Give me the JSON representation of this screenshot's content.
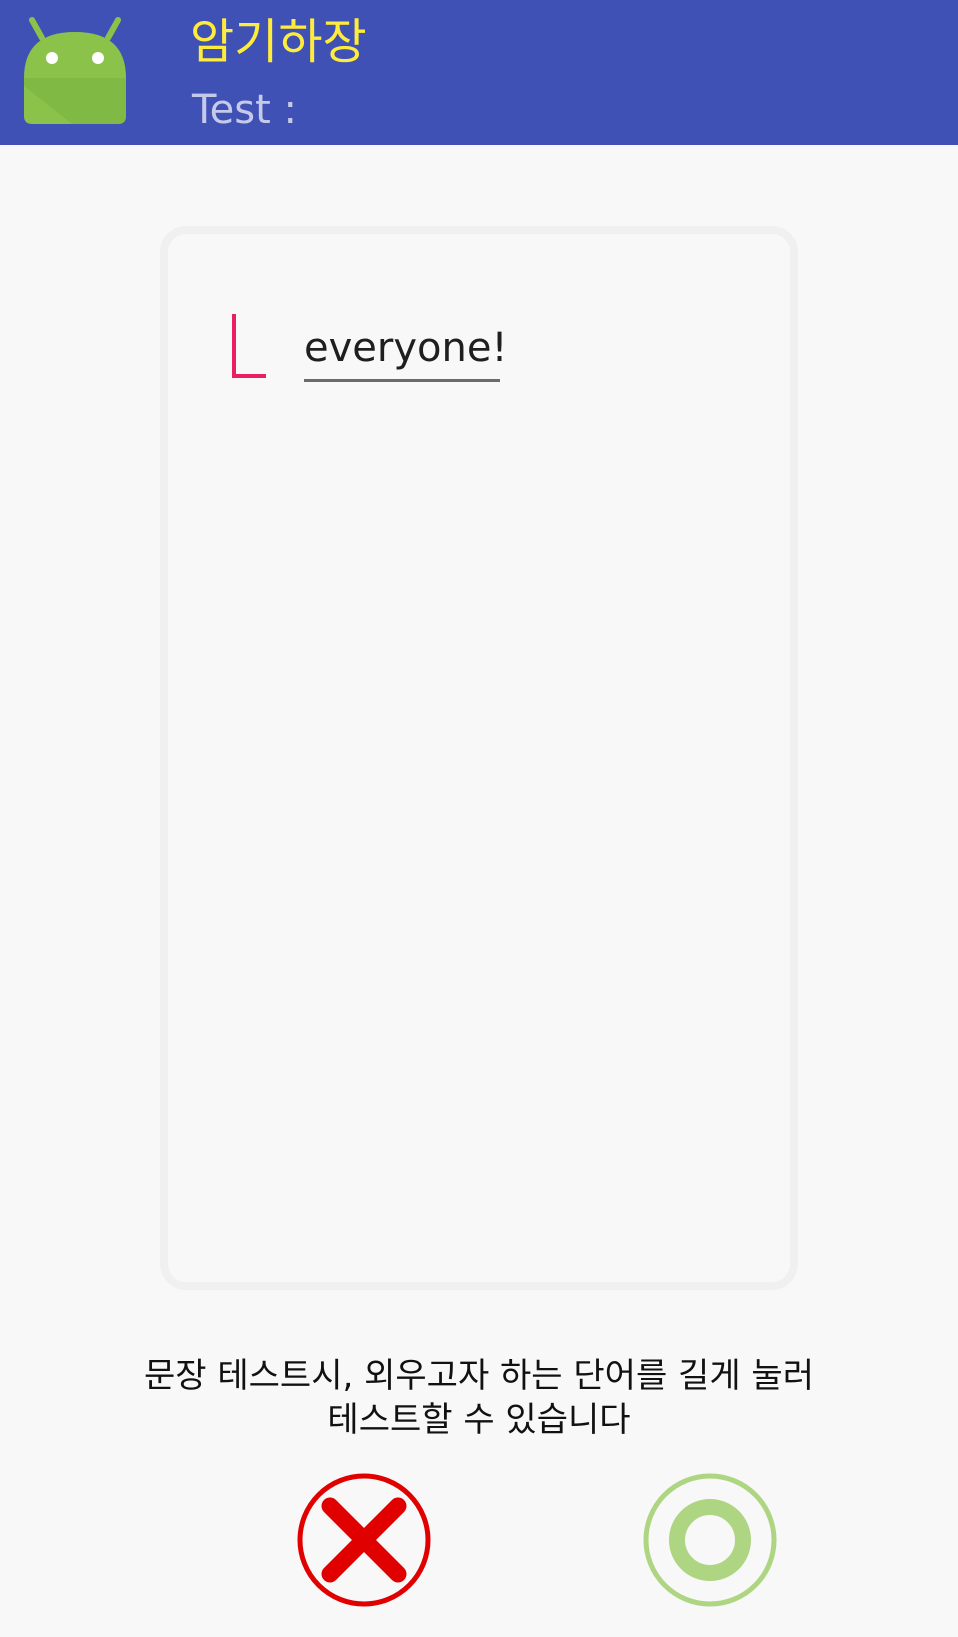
{
  "app_bar": {
    "title": "암기하장",
    "subtitle": "Test :",
    "icon": "android-icon",
    "background_color": "#3f51b5",
    "title_color": "#ffeb3b"
  },
  "card": {
    "cursor_field_value": "",
    "word_field_value": "everyone!",
    "cursor_color": "#e91e63"
  },
  "hint": {
    "line1": "문장 테스트시, 외우고자 하는 단어를 길게 눌러",
    "line2": "테스트할 수 있습니다"
  },
  "buttons": {
    "wrong": {
      "icon": "x-mark-icon",
      "color": "#e00000"
    },
    "correct": {
      "icon": "circle-icon",
      "color": "#aed581"
    }
  }
}
